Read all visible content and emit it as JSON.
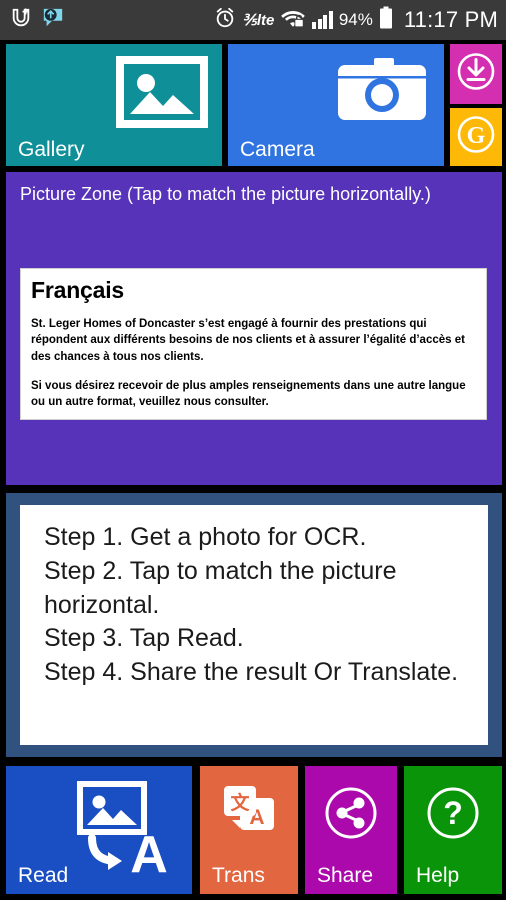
{
  "statusbar": {
    "icons": [
      "u-plus-icon",
      "speech-bubble-upload-icon",
      "alarm-clock-icon",
      "volte-icon",
      "wifi-secured-icon",
      "signal-bars-icon"
    ],
    "volte_label": "lte",
    "battery_percent": "94%",
    "time": "11:17 PM"
  },
  "top_actions": {
    "gallery_label": "Gallery",
    "camera_label": "Camera",
    "download_label": "",
    "google_label": ""
  },
  "picture_zone": {
    "title": "Picture Zone (Tap to match the picture horizontally.)",
    "document": {
      "heading": "Français",
      "paragraph_1": "St. Leger Homes of Doncaster s’est engagé à fournir des prestations qui répondent aux différents besoins de nos clients et à assurer l’égalité d’accès et des chances à tous nos clients.",
      "paragraph_2": "Si vous désirez recevoir de plus amples renseignements dans une autre langue ou un autre format, veuillez nous consulter."
    }
  },
  "steps_panel": {
    "steps": [
      "Step 1. Get a photo for OCR.",
      "Step 2. Tap to match the picture horizontal.",
      "Step 3. Tap Read.",
      "Step 4. Share the result Or Translate."
    ]
  },
  "bottom_actions": {
    "read_label": "Read",
    "trans_label": "Trans",
    "share_label": "Share",
    "help_label": "Help"
  },
  "colors": {
    "gallery": "#0f9099",
    "camera": "#2f74e0",
    "download": "#d42fb0",
    "google": "#feb908",
    "picture_zone": "#5733ba",
    "steps_panel": "#31527f",
    "read": "#1a4fc4",
    "trans": "#e2663f",
    "share": "#ab09ac",
    "help": "#0a9409",
    "statusbar": "#3a3a3a"
  }
}
